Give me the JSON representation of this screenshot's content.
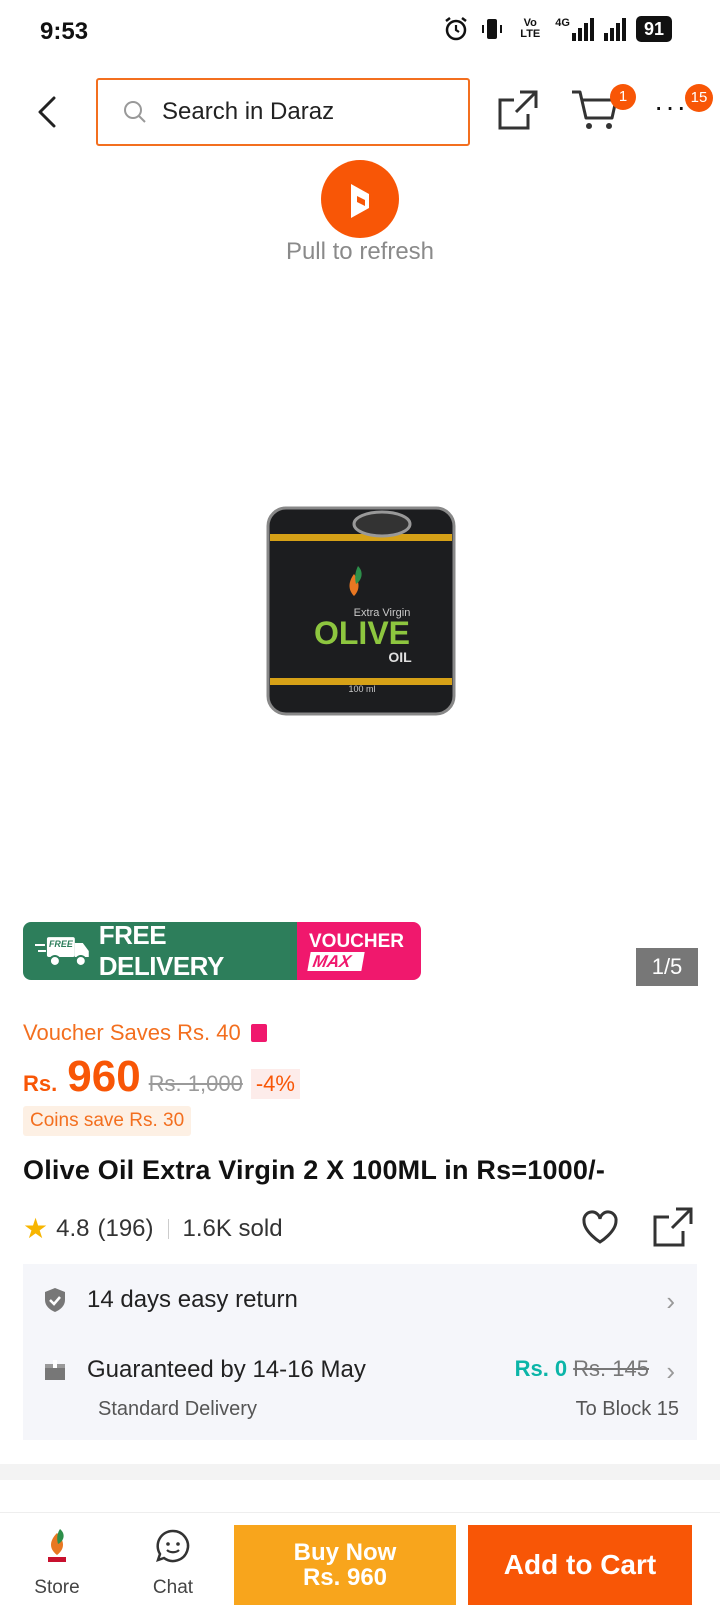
{
  "status_bar": {
    "time": "9:53",
    "network": "4G",
    "volte": "Vo LTE",
    "battery": "91"
  },
  "header": {
    "search_placeholder": "Search in Daraz",
    "cart_count": "1",
    "more_count": "15"
  },
  "refresh": {
    "label": "Pull to refresh"
  },
  "product_image": {
    "brand_text": "Extra Virgin",
    "main_text": "OLIVE",
    "sub_text": "OIL",
    "volume_text": "100 ml",
    "counter": "1/5"
  },
  "promo": {
    "free_tag": "FREE",
    "free_label": "FREE DELIVERY",
    "voucher_line1": "VOUCHER",
    "voucher_line2": "MAX"
  },
  "pricing": {
    "voucher_saves": "Voucher Saves Rs. 40",
    "currency": "Rs.",
    "price": "960",
    "old_price": "Rs. 1,000",
    "discount": "-4%",
    "coins": "Coins save Rs. 30"
  },
  "product": {
    "title": "Olive Oil Extra Virgin 2 X 100ML in Rs=1000/-",
    "rating": "4.8",
    "reviews": "(196)",
    "sold": "1.6K sold"
  },
  "service": {
    "return": "14 days easy return",
    "delivery": "Guaranteed by 14-16 May",
    "delivery_type": "Standard Delivery",
    "delivery_fee": "Rs. 0",
    "delivery_old_fee": "Rs. 145",
    "delivery_to": "To Block 15"
  },
  "bottom_bar": {
    "store": "Store",
    "chat": "Chat",
    "buy_now_line1": "Buy Now",
    "buy_now_line2": "Rs. 960",
    "add_to_cart": "Add to Cart"
  },
  "colors": {
    "brand_orange": "#f85606",
    "buy_now": "#f8a51c",
    "free_delivery_green": "#2d7e5b",
    "voucher_pink": "#f0186d",
    "free_fee_teal": "#0bb5a8"
  }
}
